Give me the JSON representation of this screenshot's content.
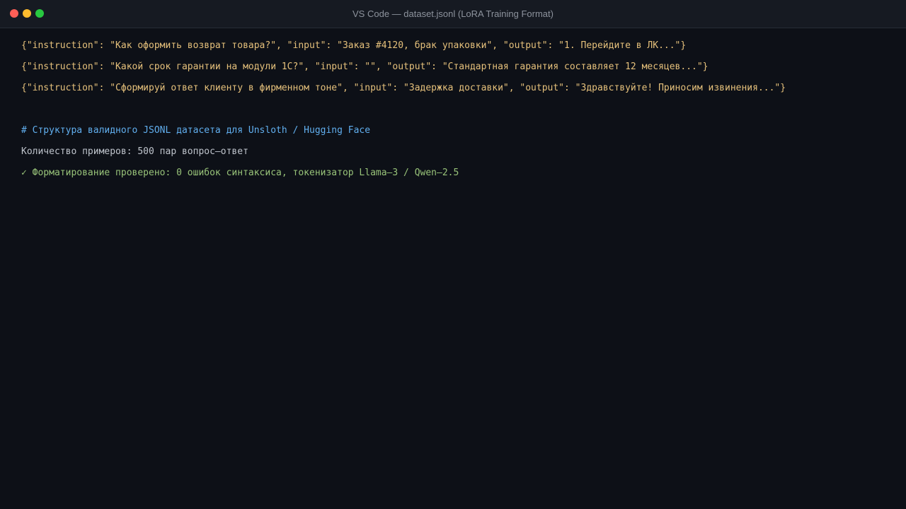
{
  "window": {
    "title": "VS Code — dataset.jsonl (LoRA Training Format)",
    "colors": {
      "background": "#0d1017",
      "titlebar": "#161a22",
      "close": "#ff5f57",
      "minimize": "#febc2e",
      "maximize": "#28c840"
    }
  },
  "editor": {
    "lines": [
      "{\"instruction\": \"Как оформить возврат товара?\", \"input\": \"Заказ #4120, брак упаковки\", \"output\": \"1. Перейдите в ЛК...\"}",
      "{\"instruction\": \"Какой срок гарантии на модули 1С?\", \"input\": \"\", \"output\": \"Стандартная гарантия составляет 12 месяцев...\"}",
      "{\"instruction\": \"Сформируй ответ клиенту в фирменном тоне\", \"input\": \"Задержка доставки\", \"output\": \"Здравствуйте! Приносим извинения...\"}",
      "# Структура валидного JSONL датасета для Unsloth / Hugging Face",
      "Количество примеров: 500 пар вопрос–ответ",
      "✓ Форматирование проверено: 0 ошибок синтаксиса, токенизатор Llama–3 / Qwen–2.5"
    ],
    "colors": {
      "json": "#e5c07b",
      "comment": "#61afef",
      "plain": "#bfc4cc",
      "success": "#98c379"
    }
  }
}
